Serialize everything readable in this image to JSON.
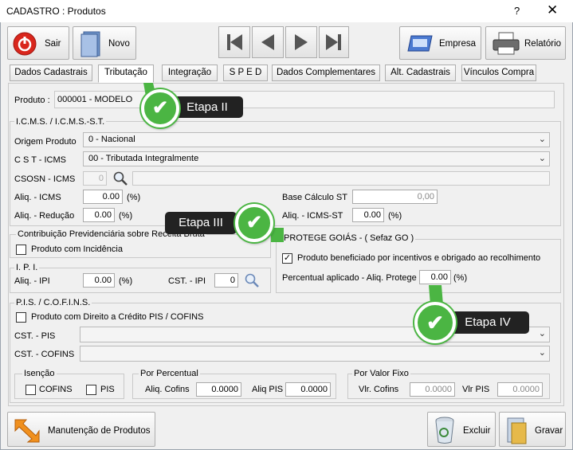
{
  "window": {
    "title": "CADASTRO : Produtos",
    "help": "?",
    "close": "✕"
  },
  "toolbar": {
    "sair": "Sair",
    "novo": "Novo",
    "empresa": "Empresa",
    "relatorio": "Relatório"
  },
  "tabs": [
    "Dados Cadastrais",
    "Tributação",
    "Integração",
    "S P E D",
    "Dados Complementares",
    "Alt. Cadastrais",
    "Vínculos Compra"
  ],
  "produto": {
    "label": "Produto :",
    "value": "000001 - MODELO"
  },
  "icms": {
    "title": "I.C.M.S. / I.C.M.S.-S.T.",
    "origem_label": "Origem Produto",
    "origem_value": "0 - Nacional",
    "cst_label": "C S T - ICMS",
    "cst_value": "00 - Tributada Integralmente",
    "csosn_label": "CSOSN - ICMS",
    "csosn_value": "0",
    "aliq_label": "Aliq. - ICMS",
    "aliq_value": "0.00",
    "pct": "(%)",
    "reducao_label": "Aliq. - Redução",
    "reducao_value": "0.00",
    "base_st_label": "Base Cálculo ST",
    "base_st_value": "0,00",
    "aliq_st_label": "Aliq. - ICMS-ST",
    "aliq_st_value": "0.00"
  },
  "contrib": {
    "title": "Contribuição Previdenciária sobre Receita Bruta",
    "check_label": "Produto com Incidência"
  },
  "ipi": {
    "title": "I. P. I.",
    "aliq_label": "Aliq. - IPI",
    "aliq_value": "0.00",
    "cst_label": "CST. - IPI",
    "cst_value": "0"
  },
  "protege": {
    "title": "PROTEGE GOIÁS  - ( Sefaz GO )",
    "check_label": "Produto beneficiado por incentivos e obrigado ao recolhimento",
    "checked": "✓",
    "perc_label": "Percentual aplicado - Aliq. Protege",
    "perc_value": "0.00",
    "pct": "(%)"
  },
  "pis": {
    "title": "P.I.S. / C.O.F.I.N.S.",
    "credito_label": "Produto com Direito a Crédito PIS / COFINS",
    "cst_pis_label": "CST. - PIS",
    "cst_cofins_label": "CST. - COFINS",
    "isencao_title": "Isenção",
    "cofins_label": "COFINS",
    "pis_label": "PIS",
    "perc_title": "Por Percentual",
    "aliq_cofins_label": "Aliq. Cofins",
    "aliq_cofins_value": "0.0000",
    "aliq_pis_label": "Aliq PIS",
    "aliq_pis_value": "0.0000",
    "fixo_title": "Por Valor Fixo",
    "vlr_cofins_label": "Vlr. Cofins",
    "vlr_cofins_value": "0.0000",
    "vlr_pis_label": "Vlr PIS",
    "vlr_pis_value": "0.0000"
  },
  "footer": {
    "manutencao": "Manutenção de Produtos",
    "excluir": "Excluir",
    "gravar": "Gravar"
  },
  "annotations": {
    "etapa2": "Etapa II",
    "etapa3": "Etapa III",
    "etapa4": "Etapa IV",
    "check": "✔"
  },
  "colors": {
    "accent_green": "#4bb543",
    "badge_bg": "#222222",
    "sair_red": "#d9261c"
  }
}
